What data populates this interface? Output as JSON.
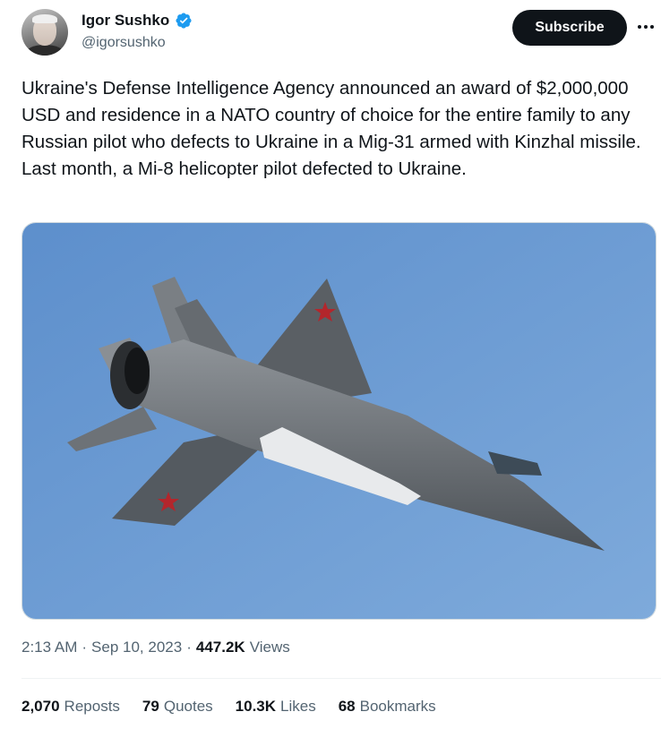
{
  "author": {
    "name": "Igor Sushko",
    "handle": "@igorsushko",
    "verified_color": "#1d9bf0"
  },
  "actions": {
    "subscribe_label": "Subscribe",
    "more_icon": "more-horizontal-icon"
  },
  "tweet": {
    "text": "Ukraine's Defense Intelligence Agency announced an award of $2,000,000 USD and residence in a NATO country of choice for the entire family to any Russian pilot who defects to Ukraine in a Mig-31 armed with Kinzhal missile. Last month, a Mi-8 helicopter pilot defected to Ukraine.",
    "image_description_icon": "fighter-jet-photo"
  },
  "meta": {
    "time": "2:13 AM",
    "date": "Sep 10, 2023",
    "separator": "·",
    "views_count": "447.2K",
    "views_label": "Views"
  },
  "stats": [
    {
      "count": "2,070",
      "label": "Reposts"
    },
    {
      "count": "79",
      "label": "Quotes"
    },
    {
      "count": "10.3K",
      "label": "Likes"
    },
    {
      "count": "68",
      "label": "Bookmarks"
    }
  ],
  "colors": {
    "sky": "#6f9dd3",
    "text_primary": "#0f1419",
    "text_secondary": "#536471"
  }
}
